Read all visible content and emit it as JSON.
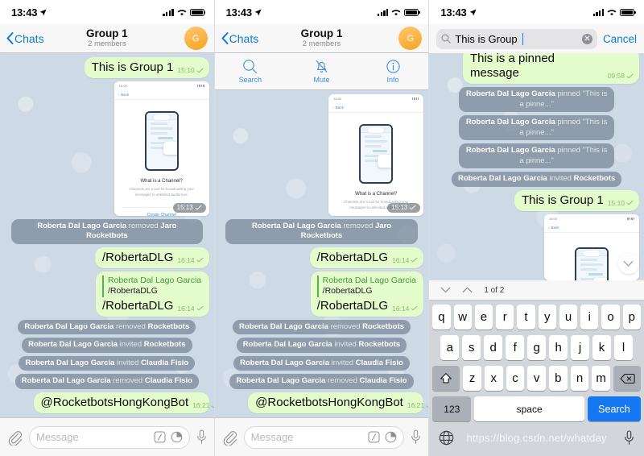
{
  "status_bar": {
    "time": "13:43",
    "location_icon": "location-arrow-icon",
    "signal_icon": "cellular-bars-icon",
    "wifi_icon": "wifi-icon",
    "battery_icon": "battery-full-icon"
  },
  "nav": {
    "back_label": "Chats",
    "title": "Group 1",
    "subtitle": "2 members",
    "avatar_initial": "G"
  },
  "action_bar": {
    "items": [
      {
        "label": "Search",
        "icon": "search-icon"
      },
      {
        "label": "Mute",
        "icon": "bell-slash-icon"
      },
      {
        "label": "Info",
        "icon": "info-circle-icon"
      }
    ]
  },
  "search": {
    "value": "This is Group",
    "icon": "search-icon",
    "clear_icon": "clear-circle-icon",
    "cancel_label": "Cancel"
  },
  "panel1": {
    "messages": [
      {
        "kind": "out",
        "text": "This is Group 1",
        "time": "15:10"
      },
      {
        "kind": "photo",
        "time": "15:13"
      },
      {
        "kind": "system",
        "name": "Roberta Dal Lago Garcia",
        "action": "removed",
        "target": "Jaro Rocketbots"
      },
      {
        "kind": "out",
        "text": "/RobertaDLG",
        "time": "16:14"
      },
      {
        "kind": "quote",
        "quote_name": "Roberta Dal Lago Garcia",
        "quote_text": "/RobertaDLG",
        "text": "/RobertaDLG",
        "time": "16:14"
      },
      {
        "kind": "system",
        "name": "Roberta Dal Lago Garcia",
        "action": "removed",
        "target": "Rocketbots"
      },
      {
        "kind": "system",
        "name": "Roberta Dal Lago Garcia",
        "action": "invited",
        "target": "Rocketbots"
      },
      {
        "kind": "system",
        "name": "Roberta Dal Lago Garcia",
        "action": "invited",
        "target": "Claudia Fisio"
      },
      {
        "kind": "system",
        "name": "Roberta Dal Lago Garcia",
        "action": "removed",
        "target": "Claudia Fisio"
      },
      {
        "kind": "out",
        "text": "@RocketbotsHongKongBot",
        "time": "16:21"
      }
    ]
  },
  "panel3": {
    "messages": [
      {
        "kind": "out",
        "text": "This is a pinned message",
        "time": "09:58"
      },
      {
        "kind": "system",
        "name": "Roberta Dal Lago Garcia",
        "action": "pinned",
        "target": "\"This is a pinne...\""
      },
      {
        "kind": "system",
        "name": "Roberta Dal Lago Garcia",
        "action": "pinned",
        "target": "\"This is a pinne...\""
      },
      {
        "kind": "system",
        "name": "Roberta Dal Lago Garcia",
        "action": "pinned",
        "target": "\"This is a pinne...\""
      },
      {
        "kind": "system",
        "name": "Roberta Dal Lago Garcia",
        "action": "invited",
        "target": "Rocketbots"
      },
      {
        "kind": "out",
        "text": "This is Group 1",
        "time": "15:10"
      }
    ]
  },
  "photo_preview": {
    "status_time": "16:00",
    "back_label": "Back",
    "title": "What is a Channel?",
    "description": "Channels are a tool for broadcasting your messages to unlimited audiences.",
    "button_label": "Create Channel"
  },
  "input_bar": {
    "placeholder": "Message",
    "attach_icon": "paperclip-icon",
    "command_icon": "slash-command-icon",
    "sticker_icon": "sticker-icon",
    "mic_icon": "microphone-icon"
  },
  "keyboard": {
    "suggest": {
      "down_icon": "chevron-down-icon",
      "up_icon": "chevron-up-icon",
      "counter": "1 of 2"
    },
    "row1": [
      "q",
      "w",
      "e",
      "r",
      "t",
      "y",
      "u",
      "i",
      "o",
      "p"
    ],
    "row2": [
      "a",
      "s",
      "d",
      "f",
      "g",
      "h",
      "j",
      "k",
      "l"
    ],
    "row3": [
      "z",
      "x",
      "c",
      "v",
      "b",
      "n",
      "m"
    ],
    "shift_icon": "shift-icon",
    "backspace_icon": "backspace-icon",
    "numeric_label": "123",
    "space_label": "space",
    "search_label": "Search",
    "globe_icon": "globe-icon",
    "dictate_icon": "microphone-icon"
  },
  "watermark": "https://blog.csdn.net/whatday",
  "colors": {
    "bubble_out": "#e4fbcb",
    "accent_blue": "#0c7ad6",
    "chat_bg": "#cdd9e5",
    "system_pill": "rgba(109,125,141,.66)",
    "keyboard_return": "#1577f2"
  }
}
